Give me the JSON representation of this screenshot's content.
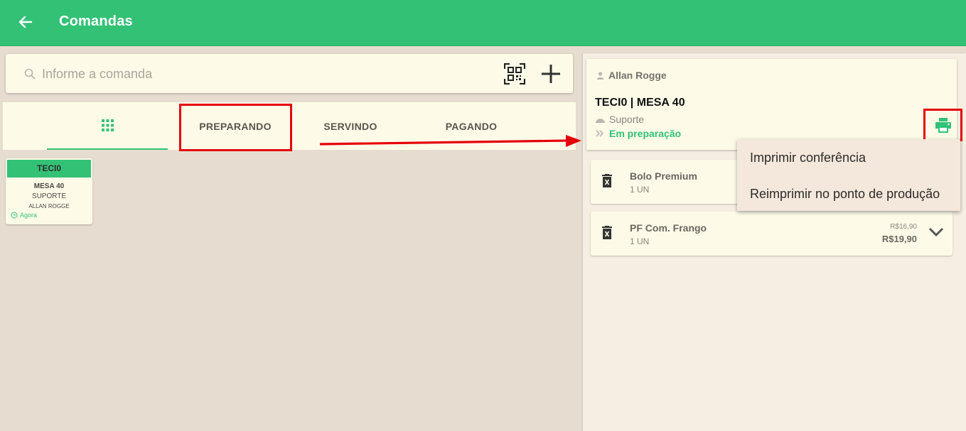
{
  "appbar": {
    "title": "Comandas"
  },
  "search": {
    "placeholder": "Informe a comanda"
  },
  "tabs": {
    "preparing": "PREPARANDO",
    "serving": "SERVINDO",
    "paying": "PAGANDO"
  },
  "card": {
    "code": "TECI0",
    "table": "MESA 40",
    "sector": "SUPORTE",
    "customer": "ALLAN ROGGE",
    "time": "Agora"
  },
  "order": {
    "customer": "Allan Rogge",
    "title": "TECI0 | MESA 40",
    "sector": "Suporte",
    "status": "Em preparação"
  },
  "items": [
    {
      "name": "Bolo Premium",
      "qty": "1 UN"
    },
    {
      "name": "PF Com. Frango",
      "qty": "1 UN",
      "old_price": "R$16,90",
      "price": "R$19,90"
    }
  ],
  "print_menu": {
    "item1": "Imprimir conferência",
    "item2": "Reimprimir no ponto de produção"
  },
  "colors": {
    "primary": "#33c176",
    "highlight": "#e6020a",
    "surface": "#fdfbe8",
    "background": "#e6ddd0"
  },
  "icons": [
    "back-arrow-icon",
    "search-icon",
    "qr-code-icon",
    "plus-icon",
    "grid-icon",
    "person-icon",
    "tray-icon",
    "double-chevron-icon",
    "printer-icon",
    "trash-icon",
    "chevron-down-icon",
    "clock-icon"
  ]
}
